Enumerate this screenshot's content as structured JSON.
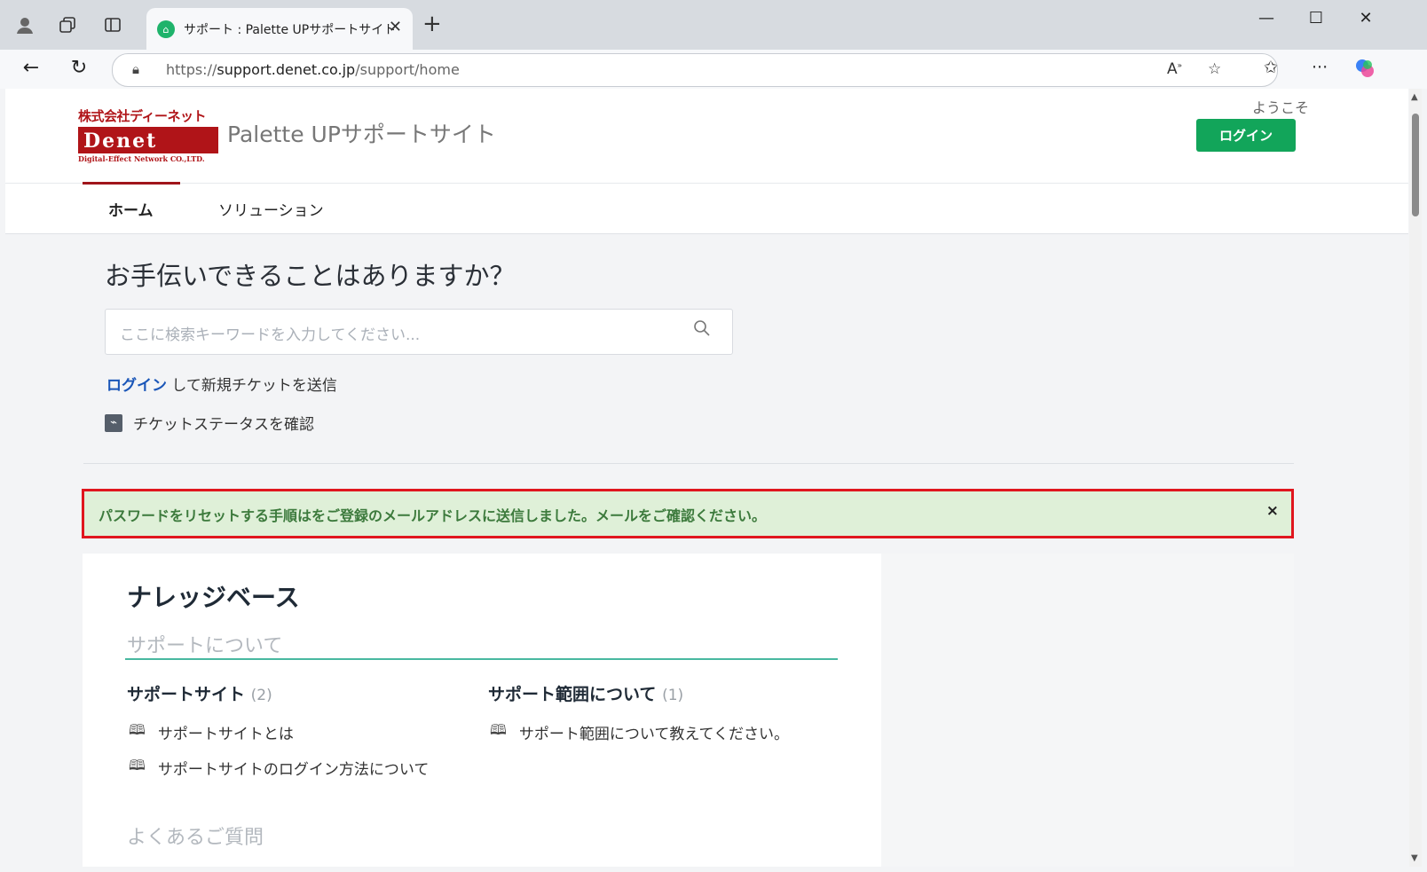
{
  "browser": {
    "tab_title": "サポート : Palette UPサポートサイト",
    "url_prefix": "https://",
    "url_host": "support.denet.co.jp",
    "url_path": "/support/home"
  },
  "site": {
    "logo": {
      "company": "株式会社ディーネット",
      "mark": "Denet",
      "tagline": "Digital-Effect Network CO.,LTD."
    },
    "title": "Palette UPサポートサイト",
    "welcome": "ようこそ",
    "login_button": "ログイン",
    "nav": [
      {
        "label": "ホーム",
        "active": true
      },
      {
        "label": "ソリューション",
        "active": false
      }
    ]
  },
  "main": {
    "help_title": "お手伝いできることはありますか？",
    "search_placeholder": "ここに検索キーワードを入力してください...",
    "login_link": "ログイン",
    "login_suffix": "して新規チケットを送信",
    "ticket_status": "チケットステータスを確認"
  },
  "alert": {
    "message": "パスワードをリセットする手順はをご登録のメールアドレスに送信しました。メールをご確認ください。",
    "close": "×"
  },
  "knowledge_base": {
    "title": "ナレッジベース",
    "section": "サポートについて",
    "categories": [
      {
        "title": "サポートサイト",
        "count": "(2)",
        "articles": [
          "サポートサイトとは",
          "サポートサイトのログイン方法について"
        ]
      },
      {
        "title": "サポート範囲について",
        "count": "(1)",
        "articles": [
          "サポート範囲について教えてください。"
        ]
      }
    ],
    "faq_title": "よくあるご質問"
  },
  "colors": {
    "brand_red": "#b01418",
    "login_green": "#12a55a",
    "alert_bg": "#dff0d8",
    "alert_border": "#e0161e",
    "link_blue": "#1a56b8"
  }
}
